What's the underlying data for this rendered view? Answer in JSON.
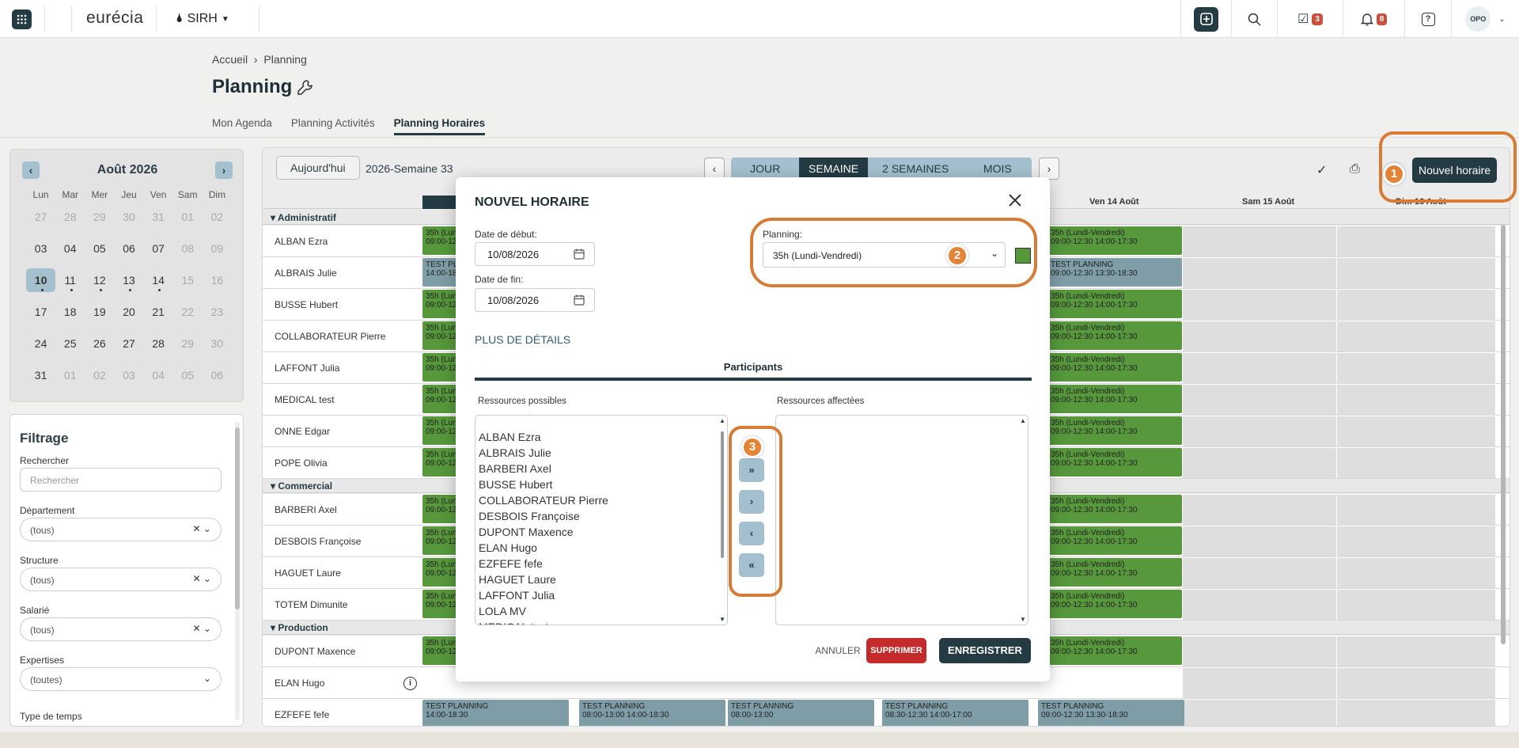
{
  "topbar": {
    "brand": "eurécia",
    "module": "SIRH",
    "badges": {
      "tasks": "3",
      "notifications": "8"
    },
    "user": "OPO"
  },
  "breadcrumb": {
    "home": "Accueil",
    "sep": "›",
    "current": "Planning"
  },
  "page_title": "Planning",
  "tabs": [
    {
      "label": "Mon Agenda"
    },
    {
      "label": "Planning Activités"
    },
    {
      "label": "Planning Horaires"
    }
  ],
  "calendar": {
    "title": "Août 2026",
    "weekdays": [
      "Lun",
      "Mar",
      "Mer",
      "Jeu",
      "Ven",
      "Sam",
      "Dim"
    ],
    "days": [
      "27",
      "28",
      "29",
      "30",
      "31",
      "01",
      "02",
      "03",
      "04",
      "05",
      "06",
      "07",
      "08",
      "09",
      "10",
      "11",
      "12",
      "13",
      "14",
      "15",
      "16",
      "17",
      "18",
      "19",
      "20",
      "21",
      "22",
      "23",
      "24",
      "25",
      "26",
      "27",
      "28",
      "29",
      "30",
      "31",
      "01",
      "02",
      "03",
      "04",
      "05",
      "06"
    ]
  },
  "filters": {
    "title": "Filtrage",
    "search_label": "Rechercher",
    "search_placeholder": "Rechercher",
    "dept_label": "Département",
    "dept_value": "(tous)",
    "struct_label": "Structure",
    "struct_value": "(tous)",
    "sal_label": "Salarié",
    "sal_value": "(tous)",
    "exp_label": "Expertises",
    "exp_value": "(toutes)",
    "type_label": "Type de temps"
  },
  "toolbar": {
    "today": "Aujourd'hui",
    "week": "2026-Semaine 33",
    "views": [
      "JOUR",
      "SEMAINE",
      "2 SEMAINES",
      "MOIS"
    ],
    "new": "Nouvel horaire"
  },
  "grid": {
    "day_headers": [
      "Ven 14 Août",
      "Sam 15 Août",
      "Dim 16 Août"
    ],
    "groups": [
      "Administratif",
      "Commercial",
      "Production"
    ],
    "people": [
      "ALBAN Ezra",
      "ALBRAIS Julie",
      "BUSSE Hubert",
      "COLLABORATEUR Pierre",
      "LAFFONT Julia",
      "MEDICAL test",
      "ONNE Edgar",
      "POPE Olivia",
      "BARBERI Axel",
      "DESBOIS Françoise",
      "HAGUET Laure",
      "TOTEM Dimunite",
      "DUPONT Maxence",
      "ELAN Hugo",
      "EZFEFE fefe"
    ],
    "std_left": "35h (Lundi-Vendredi)",
    "std_left_time": "09:00-12:30 14:00-17:30",
    "std_right": "35h (Lundi-Vendredi)",
    "std_right_time": "09:00-12:30 14:00-17:30",
    "test_left": "TEST PLANNING",
    "test_left_time": "14:00-18:30",
    "test_right": "TEST PLANNING",
    "test_right_time": "09:00-12:30 13:30-18:30",
    "ezf": [
      {
        "t": "TEST PLANNING",
        "h": "14:00-18:30"
      },
      {
        "t": "TEST PLANNING",
        "h": "08:00-13:00 14:00-18:30"
      },
      {
        "t": "TEST PLANNING",
        "h": "08:00-13:00"
      },
      {
        "t": "TEST PLANNING",
        "h": "08:30-12:30 14:00-17:00"
      },
      {
        "t": "TEST PLANNING",
        "h": "09:00-12:30 13:30-18:30"
      }
    ]
  },
  "modal": {
    "title": "NOUVEL HORAIRE",
    "start_label": "Date de début:",
    "start_value": "10/08/2026",
    "end_label": "Date de fin:",
    "end_value": "10/08/2026",
    "planning_label": "Planning:",
    "planning_value": "35h (Lundi-Vendredi)",
    "more": "PLUS DE DÉTAILS",
    "participants": "Participants",
    "possible": "Ressources possibles",
    "assigned": "Ressources affectées",
    "resources": [
      "ALBAN Ezra",
      "ALBRAIS Julie",
      "BARBERI Axel",
      "BUSSE Hubert",
      "COLLABORATEUR Pierre",
      "DESBOIS Françoise",
      "DUPONT Maxence",
      "ELAN Hugo",
      "EZFEFE fefe",
      "HAGUET Laure",
      "LAFFONT Julia",
      "LOLA MV",
      "MEDICAL test"
    ],
    "transfer": [
      "»",
      "›",
      "‹",
      "«"
    ],
    "cancel": "ANNULER",
    "delete": "SUPPRIMER",
    "save": "ENREGISTRER"
  },
  "steps": [
    "1",
    "2",
    "3"
  ],
  "colors": {
    "primary": "#243b44",
    "accent": "#a4c0cf",
    "schedule": "#56983b",
    "test": "#7f9da6",
    "highlight": "#d77c37",
    "danger": "#c62b2b"
  }
}
